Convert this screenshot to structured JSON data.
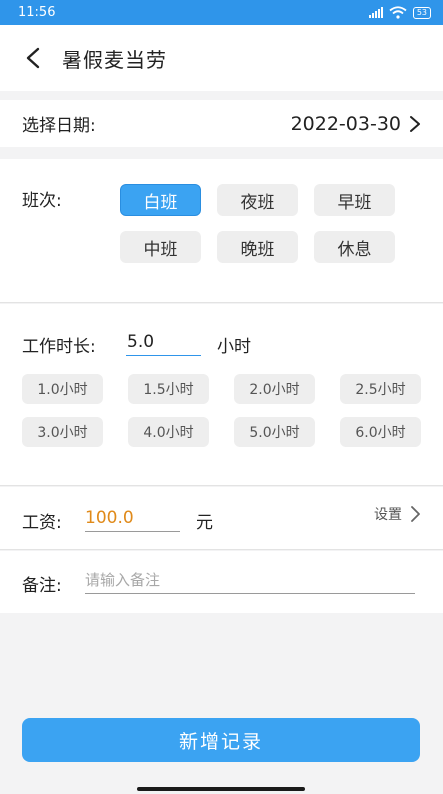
{
  "status": {
    "time": "11:56",
    "battery": "53"
  },
  "header": {
    "title": "暑假麦当劳"
  },
  "date_row": {
    "label": "选择日期:",
    "value": "2022-03-30"
  },
  "shift": {
    "label": "班次:",
    "options": [
      "白班",
      "夜班",
      "早班",
      "中班",
      "晚班",
      "休息"
    ],
    "selected": "白班"
  },
  "hours": {
    "label": "工作时长:",
    "value": "5.0",
    "unit": "小时",
    "presets": [
      "1.0小时",
      "1.5小时",
      "2.0小时",
      "2.5小时",
      "3.0小时",
      "4.0小时",
      "5.0小时",
      "6.0小时"
    ]
  },
  "wage": {
    "label": "工资:",
    "value": "100.0",
    "unit": "元",
    "setting": "设置"
  },
  "note": {
    "label": "备注:",
    "placeholder": "请输入备注"
  },
  "submit": {
    "label": "新增记录"
  },
  "colors": {
    "accent": "#3ba3f2",
    "status_bar": "#2f95ea",
    "wage_value": "#e08a1a"
  }
}
